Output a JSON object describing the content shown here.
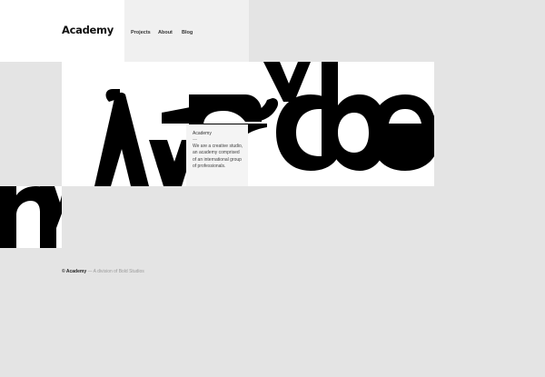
{
  "brand": {
    "logo": "Academy"
  },
  "nav": {
    "items": [
      {
        "label": "Projects"
      },
      {
        "label": "About"
      },
      {
        "label": "Blog"
      }
    ]
  },
  "hero": {
    "artwork": "abstract fragmented black letterforms"
  },
  "info_card": {
    "title": "Academy",
    "dash": "—",
    "description": "We are a creative studio, an academy comprised of an international group of professionals."
  },
  "footer": {
    "brand": "© Academy",
    "rest": " — A division of Bold Studios"
  },
  "colors": {
    "background": "#e4e4e4",
    "panel": "#ffffff",
    "nav_panel": "#f0f0f0",
    "ink": "#000000",
    "muted": "#9a9a9a"
  }
}
